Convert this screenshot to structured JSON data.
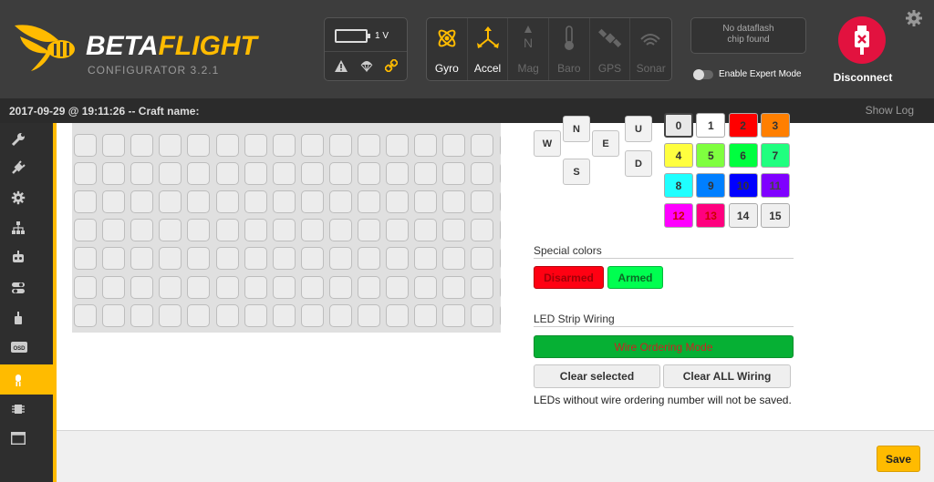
{
  "header": {
    "logo_part1": "BETA",
    "logo_part2": "FLIGHT",
    "subtitle": "CONFIGURATOR  3.2.1",
    "battery_voltage": "1 V",
    "sensors": [
      {
        "label": "Gyro",
        "icon": "gyro-icon",
        "active": true
      },
      {
        "label": "Accel",
        "icon": "accel-icon",
        "active": true
      },
      {
        "label": "Mag",
        "icon": "mag-icon",
        "active": false
      },
      {
        "label": "Baro",
        "icon": "baro-icon",
        "active": false
      },
      {
        "label": "GPS",
        "icon": "gps-icon",
        "active": false
      },
      {
        "label": "Sonar",
        "icon": "sonar-icon",
        "active": false
      }
    ],
    "dataflash_line1": "No dataflash",
    "dataflash_line2": "chip found",
    "expert_mode_label": "Enable Expert Mode",
    "disconnect_label": "Disconnect"
  },
  "statusbar": {
    "text": "2017-09-29 @ 19:11:26 -- Craft name:",
    "show_log": "Show Log"
  },
  "sidebar": {
    "items": [
      {
        "icon": "wrench-icon"
      },
      {
        "icon": "plug-icon"
      },
      {
        "icon": "gear-icon"
      },
      {
        "icon": "network-icon"
      },
      {
        "icon": "robot-icon"
      },
      {
        "icon": "toggle-switch-icon"
      },
      {
        "icon": "motor-icon"
      },
      {
        "icon": "osd-icon"
      },
      {
        "icon": "led-icon",
        "active": true
      },
      {
        "icon": "chip-icon"
      },
      {
        "icon": "terminal-icon"
      }
    ],
    "osd_label": "OSD"
  },
  "directions": {
    "n": "N",
    "w": "W",
    "e": "E",
    "s": "S",
    "u": "U",
    "d": "D"
  },
  "colors": {
    "items": [
      {
        "label": "0",
        "bg": "#e8e8e8",
        "fg": "#333"
      },
      {
        "label": "1",
        "bg": "#ffffff",
        "fg": "#333"
      },
      {
        "label": "2",
        "bg": "#ff0000",
        "fg": "#333"
      },
      {
        "label": "3",
        "bg": "#ff7f00",
        "fg": "#333"
      },
      {
        "label": "4",
        "bg": "#ffff3f",
        "fg": "#333"
      },
      {
        "label": "5",
        "bg": "#7fff3f",
        "fg": "#333"
      },
      {
        "label": "6",
        "bg": "#00ff3f",
        "fg": "#333"
      },
      {
        "label": "7",
        "bg": "#1fff7f",
        "fg": "#333"
      },
      {
        "label": "8",
        "bg": "#1fffff",
        "fg": "#333"
      },
      {
        "label": "9",
        "bg": "#007fff",
        "fg": "#333"
      },
      {
        "label": "10",
        "bg": "#0000ff",
        "fg": "#333"
      },
      {
        "label": "11",
        "bg": "#7f00ff",
        "fg": "#444"
      },
      {
        "label": "12",
        "bg": "#ff00ff",
        "fg": "#c00"
      },
      {
        "label": "13",
        "bg": "#ff007f",
        "fg": "#c00"
      },
      {
        "label": "14",
        "bg": "#efefef",
        "fg": "#333"
      },
      {
        "label": "15",
        "bg": "#efefef",
        "fg": "#333"
      }
    ]
  },
  "special_colors": {
    "title": "Special colors",
    "disarmed": "Disarmed",
    "armed": "Armed"
  },
  "wiring": {
    "title": "LED Strip Wiring",
    "wire_mode": "Wire Ordering Mode",
    "clear_selected": "Clear selected",
    "clear_all": "Clear ALL Wiring",
    "note": "LEDs without wire ordering number will not be saved."
  },
  "footer": {
    "save": "Save"
  }
}
